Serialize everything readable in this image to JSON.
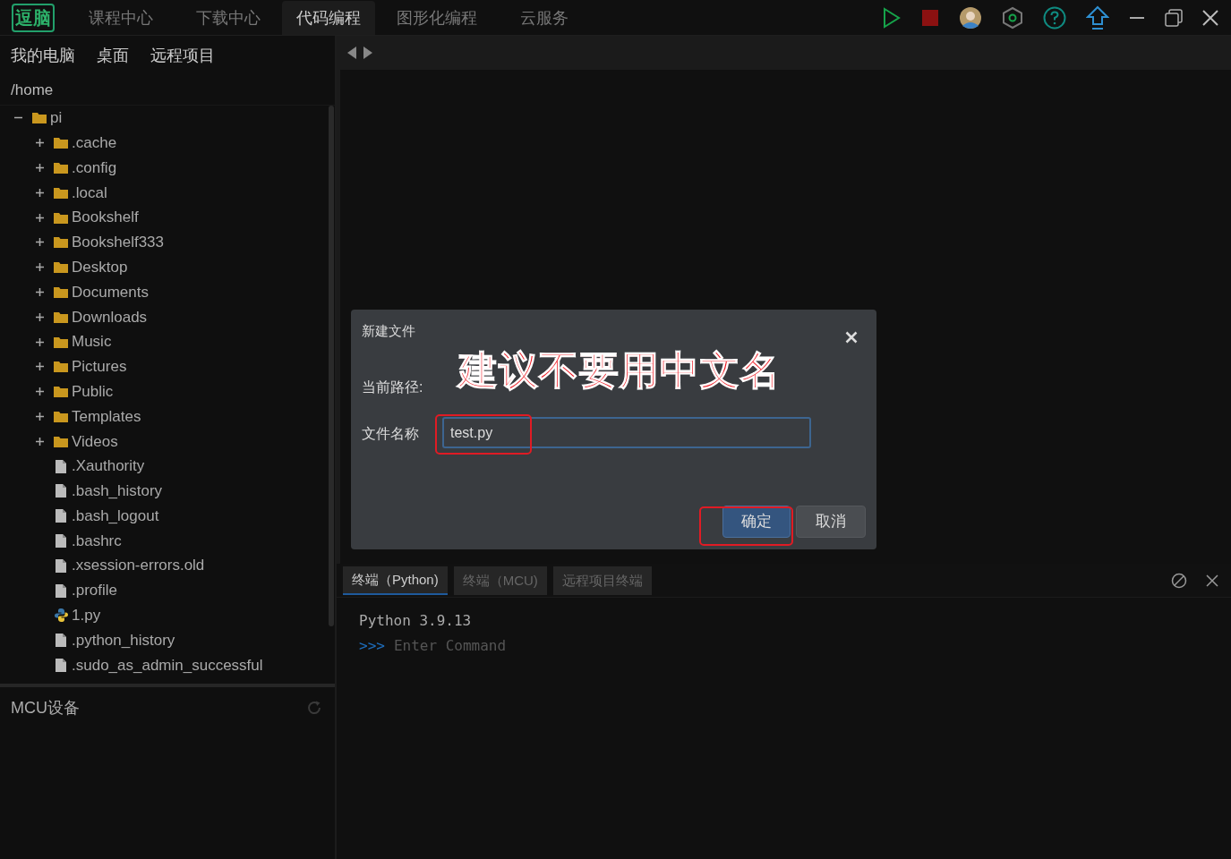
{
  "top_nav": {
    "logo": "逗脑",
    "tabs": [
      {
        "label": "课程中心",
        "selected": false
      },
      {
        "label": "下载中心",
        "selected": false
      },
      {
        "label": "代码编程",
        "selected": true
      },
      {
        "label": "图形化编程",
        "selected": false
      },
      {
        "label": "云服务",
        "selected": false
      }
    ]
  },
  "sidebar": {
    "tabs": [
      {
        "label": "我的电脑"
      },
      {
        "label": "桌面"
      },
      {
        "label": "远程项目"
      }
    ],
    "path": "/home",
    "tree": [
      {
        "kind": "folder",
        "name": "pi",
        "expanded": true,
        "children": [
          {
            "kind": "folder",
            "name": ".cache",
            "expanded": false
          },
          {
            "kind": "folder",
            "name": ".config",
            "expanded": false
          },
          {
            "kind": "folder",
            "name": ".local",
            "expanded": false
          },
          {
            "kind": "folder",
            "name": "Bookshelf",
            "expanded": false
          },
          {
            "kind": "folder",
            "name": "Bookshelf333",
            "expanded": false
          },
          {
            "kind": "folder",
            "name": "Desktop",
            "expanded": false
          },
          {
            "kind": "folder",
            "name": "Documents",
            "expanded": false
          },
          {
            "kind": "folder",
            "name": "Downloads",
            "expanded": false
          },
          {
            "kind": "folder",
            "name": "Music",
            "expanded": false
          },
          {
            "kind": "folder",
            "name": "Pictures",
            "expanded": false
          },
          {
            "kind": "folder",
            "name": "Public",
            "expanded": false
          },
          {
            "kind": "folder",
            "name": "Templates",
            "expanded": false
          },
          {
            "kind": "folder",
            "name": "Videos",
            "expanded": false
          },
          {
            "kind": "file",
            "name": ".Xauthority"
          },
          {
            "kind": "file",
            "name": ".bash_history"
          },
          {
            "kind": "file",
            "name": ".bash_logout"
          },
          {
            "kind": "file",
            "name": ".bashrc"
          },
          {
            "kind": "file",
            "name": ".xsession-errors.old"
          },
          {
            "kind": "file",
            "name": ".profile"
          },
          {
            "kind": "python",
            "name": "1.py"
          },
          {
            "kind": "file",
            "name": ".python_history"
          },
          {
            "kind": "file",
            "name": ".sudo_as_admin_successful"
          }
        ]
      }
    ],
    "mcu_panel": {
      "title": "MCU设备"
    }
  },
  "dialog": {
    "title": "新建文件",
    "path_label": "当前路径:",
    "name_label": "文件名称",
    "name_value": "test.py",
    "buttons": [
      {
        "label": "确定",
        "kind": "primary"
      },
      {
        "label": "取消",
        "kind": "secondary"
      }
    ]
  },
  "annotation": {
    "text": "建议不要用中文名"
  },
  "terminal": {
    "tabs": [
      {
        "label": "终端（Python)",
        "selected": true
      },
      {
        "label": "终端（MCU)",
        "selected": false
      },
      {
        "label": "远程项目终端",
        "selected": false
      }
    ],
    "lines": [
      "Python 3.9.13"
    ],
    "prompt": ">>>",
    "placeholder": "Enter Command"
  }
}
